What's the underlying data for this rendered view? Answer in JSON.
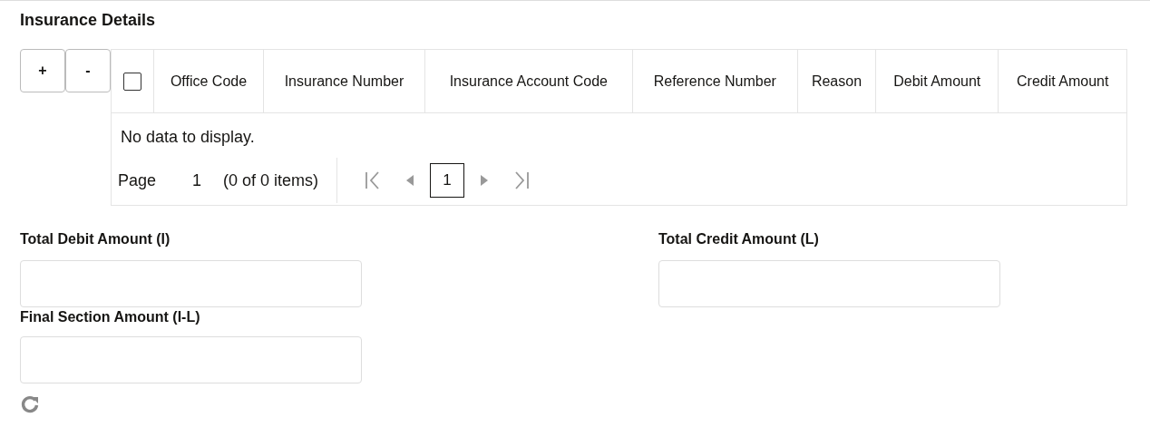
{
  "section_title": "Insurance Details",
  "row_buttons": [
    "+",
    "-"
  ],
  "table": {
    "select_all": {
      "checked": false
    },
    "columns": [
      "Office Code",
      "Insurance Number",
      "Insurance Account Code",
      "Reference Number",
      "Reason",
      "Debit Amount",
      "Credit Amount"
    ],
    "empty_message": "No data to display.",
    "pager": {
      "page_label": "Page",
      "page_value": "1",
      "items_summary": "(0 of 0 items)",
      "pages": [
        {
          "label": "1",
          "selected": true
        }
      ]
    }
  },
  "fields": [
    {
      "label": "Total Debit Amount (I)"
    },
    {
      "label": "Total Credit Amount (L)"
    },
    {
      "label": "Final Section Amount (I-L)"
    }
  ]
}
